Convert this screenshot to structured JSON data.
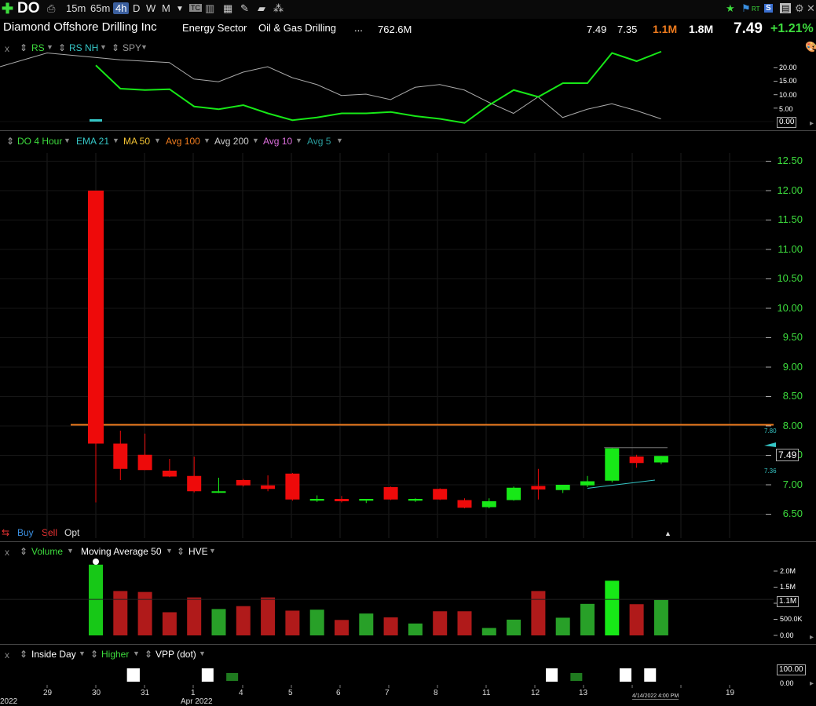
{
  "toolbar": {
    "symbol": "DO",
    "timeframes": [
      "15m",
      "65m",
      "4h",
      "D",
      "W",
      "M"
    ],
    "selected_timeframe": "4h",
    "icons": [
      "plus-icon",
      "print-icon",
      "chevron-down-icon",
      "tc-icon",
      "grid-icon",
      "calculator-icon",
      "pencil-icon",
      "layers-icon",
      "share-icon"
    ],
    "right_icons": [
      "star-icon",
      "pin-icon",
      "rt-icon",
      "settings-icon",
      "window-icon",
      "x-icon"
    ],
    "rt_label": "RT",
    "s_label": "S"
  },
  "header": {
    "company": "Diamond Offshore Drilling Inc",
    "sector": "Energy Sector",
    "industry": "Oil & Gas Drilling",
    "ellipsis": "...",
    "market_cap": "762.6M",
    "high": "7.49",
    "low": "7.35",
    "volume": "1.1M",
    "avg_volume": "1.8M",
    "last": "7.49",
    "change": "+1.21%"
  },
  "rs_panel": {
    "close": "x",
    "labels": [
      "RS",
      "RS NH",
      "SPY"
    ],
    "axis": [
      "20.00",
      "15.00",
      "10.00",
      "5.00"
    ],
    "current": "0.00"
  },
  "price_panel": {
    "indicators": [
      "DO 4 Hour",
      "EMA 21",
      "MA 50",
      "Avg 100",
      "Avg 200",
      "Avg 10",
      "Avg 5"
    ],
    "indicator_colors": [
      "#3ddc3d",
      "#35c6c6",
      "#f2c233",
      "#f07c1e",
      "#cccccc",
      "#e070e0",
      "#2a9e9e"
    ],
    "axis": [
      "12.50",
      "12.00",
      "11.50",
      "11.00",
      "10.50",
      "10.00",
      "9.50",
      "9.00",
      "8.50",
      "8.00",
      "7.50",
      "7.00",
      "6.50"
    ],
    "level_upper": "7.80",
    "level_lower": "7.36",
    "current": "7.49",
    "buy": "Buy",
    "sell": "Sell",
    "opt": "Opt"
  },
  "volume_panel": {
    "close": "x",
    "labels": [
      "Volume",
      "Moving Average 50",
      "HVE"
    ],
    "axis": [
      "2.0M",
      "1.5M",
      "1.0M",
      "500.0K",
      "0.00"
    ],
    "current": "1.1M"
  },
  "signal_panel": {
    "close": "x",
    "labels": [
      "Inside Day",
      "Higher",
      "VPP (dot)"
    ],
    "axis_top": "100.00",
    "axis_bottom": "0.00"
  },
  "date_axis": {
    "labels": [
      "2022",
      "29",
      "30",
      "31",
      "1",
      "Apr 2022",
      "4",
      "5",
      "6",
      "7",
      "8",
      "11",
      "12",
      "13",
      "19"
    ],
    "cursor": "4/14/2022 4:00 PM"
  },
  "chart_data": {
    "type": "candlestick",
    "title": "DO 4 Hour",
    "ylim": [
      6.3,
      12.7
    ],
    "horizontal_line": 8.02,
    "candles": [
      {
        "open": 12.0,
        "high": 12.0,
        "low": 6.7,
        "close": 7.7,
        "up": false,
        "volume": 2.2
      },
      {
        "open": 7.7,
        "high": 7.92,
        "low": 7.08,
        "close": 7.27,
        "up": false,
        "volume": 1.38
      },
      {
        "open": 7.51,
        "high": 7.87,
        "low": 7.25,
        "close": 7.25,
        "up": false,
        "volume": 1.35
      },
      {
        "open": 7.24,
        "high": 7.44,
        "low": 7.13,
        "close": 7.14,
        "up": false,
        "volume": 0.72
      },
      {
        "open": 7.15,
        "high": 7.48,
        "low": 6.87,
        "close": 6.89,
        "up": false,
        "volume": 1.18
      },
      {
        "open": 6.88,
        "high": 7.12,
        "low": 6.86,
        "close": 6.89,
        "up": true,
        "volume": 0.82
      },
      {
        "open": 7.08,
        "high": 7.1,
        "low": 6.97,
        "close": 6.99,
        "up": false,
        "volume": 0.91
      },
      {
        "open": 6.99,
        "high": 7.16,
        "low": 6.89,
        "close": 6.93,
        "up": false,
        "volume": 1.18
      },
      {
        "open": 7.19,
        "high": 7.2,
        "low": 6.73,
        "close": 6.75,
        "up": false,
        "volume": 0.77
      },
      {
        "open": 6.73,
        "high": 6.82,
        "low": 6.71,
        "close": 6.76,
        "up": true,
        "volume": 0.8
      },
      {
        "open": 6.76,
        "high": 6.81,
        "low": 6.7,
        "close": 6.72,
        "up": false,
        "volume": 0.48
      },
      {
        "open": 6.73,
        "high": 6.76,
        "low": 6.69,
        "close": 6.76,
        "up": true,
        "volume": 0.68
      },
      {
        "open": 6.96,
        "high": 6.97,
        "low": 6.74,
        "close": 6.75,
        "up": false,
        "volume": 0.56
      },
      {
        "open": 6.73,
        "high": 6.77,
        "low": 6.71,
        "close": 6.76,
        "up": true,
        "volume": 0.37
      },
      {
        "open": 6.93,
        "high": 6.94,
        "low": 6.74,
        "close": 6.75,
        "up": false,
        "volume": 0.75
      },
      {
        "open": 6.74,
        "high": 6.77,
        "low": 6.6,
        "close": 6.61,
        "up": false,
        "volume": 0.75
      },
      {
        "open": 6.62,
        "high": 6.77,
        "low": 6.6,
        "close": 6.72,
        "up": true,
        "volume": 0.23
      },
      {
        "open": 6.74,
        "high": 6.97,
        "low": 6.73,
        "close": 6.95,
        "up": true,
        "volume": 0.49
      },
      {
        "open": 6.98,
        "high": 7.27,
        "low": 6.75,
        "close": 6.92,
        "up": false,
        "volume": 1.38
      },
      {
        "open": 6.91,
        "high": 7.0,
        "low": 6.86,
        "close": 7.0,
        "up": true,
        "volume": 0.55
      },
      {
        "open": 6.99,
        "high": 7.15,
        "low": 6.96,
        "close": 7.06,
        "up": true,
        "volume": 0.98
      },
      {
        "open": 7.07,
        "high": 7.63,
        "low": 7.04,
        "close": 7.62,
        "up": true,
        "volume": 1.7
      },
      {
        "open": 7.48,
        "high": 7.51,
        "low": 7.29,
        "close": 7.37,
        "up": false,
        "volume": 0.97
      },
      {
        "open": 7.38,
        "high": 7.49,
        "low": 7.35,
        "close": 7.49,
        "up": true,
        "volume": 1.1
      }
    ],
    "rs_line": [
      20.5,
      12.0,
      11.5,
      11.8,
      5.5,
      4.5,
      6.0,
      3.0,
      0.5,
      1.5,
      3.0,
      3.0,
      3.5,
      2.0,
      1.0,
      -0.5,
      6.0,
      11.5,
      9.0,
      14.0,
      14.0,
      25.0,
      22.0,
      25.5
    ],
    "spy_line": [
      25.0,
      22.5,
      22.0,
      21.5,
      15.5,
      14.5,
      18.0,
      20.0,
      16.0,
      13.5,
      9.5,
      10.0,
      8.0,
      12.5,
      13.5,
      11.5,
      7.0,
      3.0,
      9.0,
      1.5,
      4.5,
      6.5,
      4.0,
      1.0
    ],
    "volume_ma": 1.12,
    "signal_bars": [
      {
        "index": 1,
        "color": "#ffffff"
      },
      {
        "index": 2,
        "color": "#ffffff"
      },
      {
        "index": 5,
        "color": "#ffffff"
      },
      {
        "index": 6,
        "color": "#1f7a1f"
      },
      {
        "index": 19,
        "color": "#ffffff"
      },
      {
        "index": 20,
        "color": "#1f7a1f"
      },
      {
        "index": 22,
        "color": "#ffffff"
      },
      {
        "index": 23,
        "color": "#ffffff"
      }
    ],
    "volume_units": "M",
    "grid": true
  }
}
